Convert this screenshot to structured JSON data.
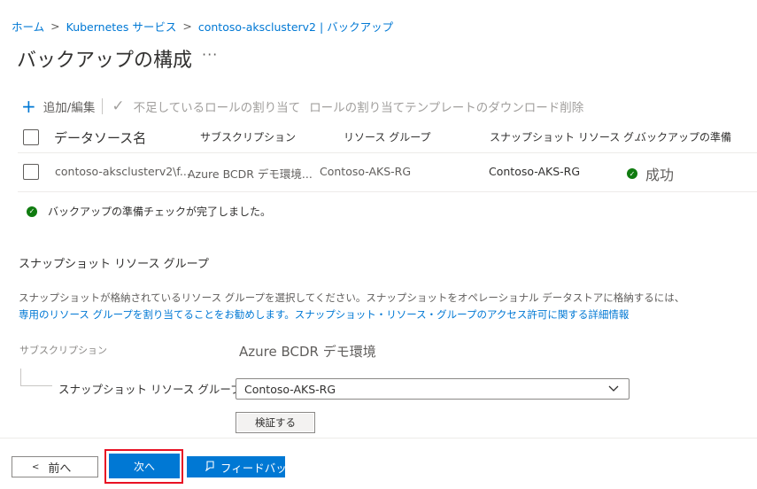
{
  "breadcrumb": {
    "home": "ホーム",
    "k8s": "Kubernetes サービス",
    "current": "contoso-aksclusterv2 | バックアップ",
    "separator": ">"
  },
  "page": {
    "title": "バックアップの構成",
    "more": "···"
  },
  "toolbar": {
    "add_edit": "追加/編集",
    "assign_missing": "不足しているロールの割り当て",
    "download_template": "ロールの割り当てテンプレートのダウンロード",
    "delete": "削除"
  },
  "table": {
    "headers": [
      "データソース名",
      "サブスクリプション",
      "リソース グループ",
      "スナップショット リソース グ...",
      "バックアップの準備"
    ],
    "rows": [
      {
        "datasource": "contoso-aksclusterv2\\f...",
        "subscription": "Azure BCDR デモ環境...",
        "resource_group": "Contoso-AKS-RG",
        "snapshot_rg": "Contoso-AKS-RG",
        "status": "成功"
      }
    ]
  },
  "check_message": "バックアップの準備チェックが完了しました。",
  "snapshot_section": {
    "title": "スナップショット リソース グループ",
    "desc_line1": "スナップショットが格納されているリソース グループを選択してください。スナップショットをオペレーショナル データストアに格納するには、",
    "desc_line2_link": "専用のリソース グループを割り当てることをお勧めします。スナップショット・リソース・グループのアクセス許可に関する詳細情報",
    "subscription_label": "サブスクリプション",
    "subscription_value": "Azure BCDR デモ環境",
    "rg_label": "スナップショット リソース グループ",
    "rg_value": "Contoso-AKS-RG",
    "verify_label": "検証する"
  },
  "footer": {
    "prev_label": "前へ",
    "next_label": "次へ",
    "feedback_label": "フィードバック"
  },
  "colors": {
    "accent": "#0078d4",
    "success": "#107c10",
    "highlight": "#e81123"
  },
  "icons": {
    "add": "plus-icon",
    "check": "checkmark-icon",
    "download": "download-icon",
    "status": "success-check-icon",
    "dropdown": "chevron-down-icon",
    "prev": "chevron-left-icon",
    "feedback": "feedback-icon"
  }
}
